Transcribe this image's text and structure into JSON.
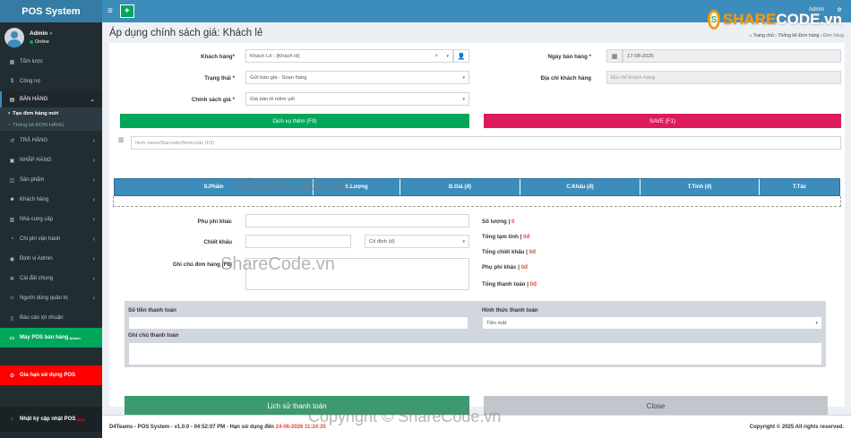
{
  "app": {
    "title": "POS System"
  },
  "user": {
    "name": "Admin",
    "status": "Online"
  },
  "sidebar": {
    "items": [
      {
        "label": "Tổm lược",
        "icon": "dashboard-icon"
      },
      {
        "label": "Công nợ",
        "icon": "money-icon"
      }
    ],
    "sales": {
      "label": "BÁN HÀNG",
      "sub": [
        "Tạo đơn hàng mới",
        "Thống kê ĐƠN HÀNG"
      ]
    },
    "items2": [
      {
        "label": "TRẢ HÀNG"
      },
      {
        "label": "NHẬP HÀNG"
      },
      {
        "label": "Sản phẩm"
      },
      {
        "label": "Khách hàng"
      },
      {
        "label": "Nhà cung cấp"
      },
      {
        "label": "Chi phí vận hành"
      },
      {
        "label": "Định vị Admin"
      },
      {
        "label": "Cài đặt chung"
      },
      {
        "label": "Người dùng quản trị"
      },
      {
        "label": "Báo cáo lợi nhuận"
      }
    ],
    "pos_machine": {
      "label": "Máy POS bán hàng",
      "sup": "Admin"
    },
    "pos_expiry": {
      "label": "Gia hạn sử dụng POS"
    },
    "changelog": {
      "label": "Nhật ký cập nhật POS",
      "sup": "NEW"
    }
  },
  "topbar": {
    "user": "Admin"
  },
  "brand": {
    "text_a": "SHARE",
    "text_b": "CODE.vn"
  },
  "page": {
    "title": "Áp dụng chính sách giá: Khách lẻ",
    "breadcrumb": [
      "Trang chủ",
      "Thống kê Đơn hàng",
      "Đơn hàng"
    ]
  },
  "form": {
    "customer_label": "Khách hàng*",
    "customer_value": "Khách Lẻ - [Khách lẻ]",
    "status_label": "Trạng thái *",
    "status_value": "Gửi báo giá - Soạn hàng",
    "policy_label": "Chính sách giá *",
    "policy_value": "Giá bán lẻ niêm yết",
    "date_label": "Ngày bán hàng *",
    "date_value": "17-08-2025",
    "address_label": "Địa chỉ khách hàng",
    "address_placeholder": "Địa chỉ khách hàng",
    "service_button": "Dịch vụ thêm (F9)",
    "save_button": "SAVE (F1)",
    "item_placeholder": "Item name/Barcode/Itemcode (F3)"
  },
  "table": {
    "columns": [
      "S.Phẩm",
      "S.Lượng",
      "Đ.Giá (đ)",
      "C.Khấu (đ)",
      "T.Tính (đ)",
      "T.Tác"
    ]
  },
  "extra": {
    "fee_label": "Phụ phí khác",
    "discount_label": "Chiết khấu",
    "discount_type": "Cố định (đ)",
    "note_label": "Ghi chú đơn hàng (F8)"
  },
  "summary": [
    {
      "label": "Số lượng",
      "value": "0"
    },
    {
      "label": "Tổng tạm tính",
      "value": "0đ"
    },
    {
      "label": "Tổng chiết khấu",
      "value": "0đ"
    },
    {
      "label": "Phụ phí khác",
      "value": "0đ"
    },
    {
      "label": "Tổng thanh toán",
      "value": "0đ"
    }
  ],
  "payment": {
    "amount_label": "Số tiền thanh toán",
    "method_label": "Hình thức thanh toán",
    "method_value": "Tiền mặt",
    "note_label": "Ghi chú thanh toán"
  },
  "actions": {
    "history": "Lịch sử thanh toán",
    "close": "Close"
  },
  "footer": {
    "left": "D4Teams - POS System - v1.0.0 - 04:52:07 PM - Hạn sử dụng đến",
    "deadline": "24-06-2026 11:24:35",
    "right": "Copyright © 2025 All rights reserved."
  },
  "watermarks": {
    "w1": "ShareCode.vn",
    "w2": "ShareCode.vn",
    "w3": "Copyright © ShareCode.vn"
  },
  "colors": {
    "primary": "#3c8dbc",
    "green": "#00a65a",
    "pink": "#dd1b5c",
    "sidebar": "#222d32"
  }
}
